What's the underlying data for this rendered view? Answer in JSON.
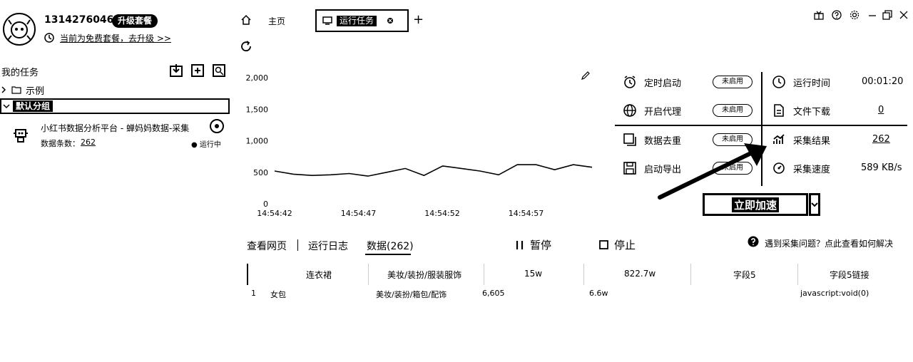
{
  "user": {
    "phone": "13142760460",
    "vip_badge": "升级套餐",
    "notice": "当前为免费套餐，去升级 >>"
  },
  "sidebar": {
    "title": "我的任务",
    "example_label": "示例",
    "group_label": "默认分组",
    "task": {
      "name": "小红书数据分析平台 - 蝉妈妈数据-采集",
      "count_label": "数据条数：",
      "count": "262",
      "status": "运行中"
    }
  },
  "tabs": {
    "home": "主页",
    "running": "运行任务",
    "add": "+"
  },
  "chart_data": {
    "type": "line",
    "x": [
      "14:54:42",
      "14:54:47",
      "14:54:52",
      "14:54:57"
    ],
    "yticks": [
      "2,000",
      "1,500",
      "1,000",
      "500",
      "0"
    ],
    "ylim": [
      0,
      2000
    ],
    "series": [
      {
        "values": [
          520,
          470,
          450,
          460,
          480,
          440,
          500,
          560,
          450,
          600,
          560,
          520,
          460,
          620,
          620,
          540,
          620,
          580
        ]
      }
    ]
  },
  "stats": {
    "scheduled_start": "定时启动",
    "proxy": "开启代理",
    "dedupe": "数据去重",
    "auto_export": "启动导出",
    "toggle_off": "未启用",
    "runtime_label": "运行时间",
    "runtime_value": "00:01:20",
    "download_label": "文件下载",
    "download_value": "0",
    "result_label": "采集结果",
    "result_value": "262",
    "speed_label": "采集速度",
    "speed_value": "589 KB/s"
  },
  "actions": {
    "boost": "立即加速",
    "pause": "暂停",
    "stop": "停止"
  },
  "bottom_tabs": {
    "view_page": "查看网页",
    "run_log": "运行日志",
    "data": "数据(262)"
  },
  "help": "遇到采集问题？点此查看如何解决",
  "table": {
    "headers": [
      "连衣裙",
      "美妆/装扮/服装服饰",
      "15w",
      "822.7w",
      "字段5",
      "字段5链接"
    ],
    "rows": [
      [
        "1",
        "女包",
        "美妆/装扮/箱包/配饰",
        "6,605",
        "6.6w",
        "",
        "javascript:void(0)"
      ]
    ]
  }
}
